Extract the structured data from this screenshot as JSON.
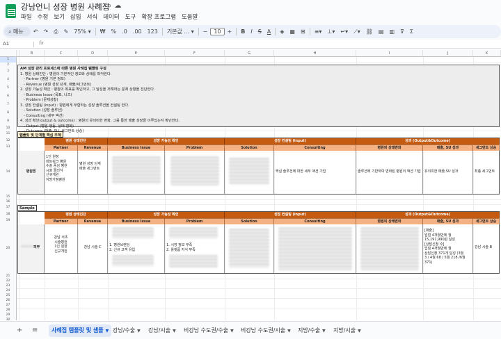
{
  "app": {
    "title": "강남언니 성장 병원 사례집",
    "title_icons": [
      "star-icon",
      "move-to-folder-icon",
      "cloud-status-icon"
    ],
    "menus": [
      "파일",
      "수정",
      "보기",
      "삽입",
      "서식",
      "데이터",
      "도구",
      "확장 프로그램",
      "도움말"
    ]
  },
  "toolbar": {
    "search_label": "메뉴",
    "zoom": "75%",
    "currency": "₩",
    "percent": "%",
    "dec_decrease": ".0",
    "dec_increase": ".00",
    "number_format": "123",
    "font_name": "기본값 ...",
    "font_size": "10"
  },
  "formula_bar": {
    "cell_ref": "A1",
    "fx": "fx"
  },
  "columns": [
    "A",
    "B",
    "C",
    "D",
    "E",
    "F",
    "G",
    "H",
    "I",
    "J",
    "K"
  ],
  "rows": [
    "1",
    "2",
    "3",
    "4",
    "5",
    "6",
    "7",
    "8",
    "9",
    "10",
    "11",
    "12",
    "13",
    "14",
    "15",
    "16",
    "17",
    "18",
    "19",
    "20",
    "21",
    "22",
    "23",
    "24",
    "25",
    "26",
    "27",
    "28",
    "29",
    "30"
  ],
  "instructions": {
    "title": "AM 성장 관리 프로세스에 따른 병원 사례집 템플릿 구성",
    "lines": [
      "1. 병원 상태진단 : 병원의 기본적인 정보와 상태를 파악한다.",
      "   - Partner (병원 기본 정보)",
      "   - Revenue (병원 성장 단계, 매출/세그먼트)",
      "2. 성장 가능성 확인 : 병원의 목표를 확인하고, 그 달성을 저해하는 문제 상황을 진단한다.",
      "   - Business Issue (목표, 니즈)",
      "   - Problem (문제상황)",
      "3. 성장 컨설팅 (input) : 병원에게 부합하는 성장 솔루션을 컨설팅 한다.",
      "   - Solution (성장 솔루션)",
      "   - Consulting (세부 액션)",
      "4. 성과 확인(output & outcome) : 병원의 유의미한 변화, 그를 통한 매출 성장을 이루었는지 확인한다.",
      "   - Output (병원 행동, 상태 변화)",
      "   - Outcome (매출, SU, 세그먼트 상승)"
    ]
  },
  "template_table": {
    "label": "템플릿 및 단계별 핵심 주제",
    "header1": [
      "병원 상태진단",
      "성장 가능성 확인",
      "성장 컨설팅 (input)",
      "성과 (Output&Outcome)"
    ],
    "header2": [
      "Partner",
      "Revenue",
      "Business Issue",
      "Problem",
      "Solution",
      "Consulting",
      "병원의 상태변화",
      "매출, SU 성과",
      "세그먼트 상승"
    ],
    "row_label": "병원명",
    "partner_lines": [
      "1인 원장",
      "네트워크 병원",
      "수술 중심 병원",
      "시술 클리닉",
      "신규개원",
      "지방가점병원"
    ],
    "revenue_lines": [
      "병원 성장 단계",
      "매출 세그먼트"
    ],
    "consulting": "핵심 솔루션에 대한 세부 액션 기입",
    "state_change": "솔루션에 기반하여 변화된 병원의 액션 기입",
    "sales_result": "유의미한 매출,SU 성과",
    "segment_result": "최종 세그먼트"
  },
  "sample_table": {
    "label": "Sample",
    "header1": [
      "병원 상태진단",
      "성장 가능성 확인",
      "성장 컨설팅 (input)",
      "성과 (Output&Outcome)"
    ],
    "header2": [
      "Partner",
      "Revenue",
      "Business Issue",
      "Problem",
      "Solution",
      "Consulting",
      "병원의 상태변화",
      "매출, SU 성과",
      "세그먼트 상승"
    ],
    "row_label_suffix": "피부",
    "partner_lines": [
      "강남 서초",
      "시술병원",
      "1인 원장",
      "신규개원"
    ],
    "revenue": "강남 시술 C",
    "business_issue_lines": [
      "1. 병원브랜딩",
      "2. 신규 고객 유입"
    ],
    "problem_lines": [
      "1. 시장 정보 부족",
      "2. 플랫폼 지식 부족"
    ],
    "sales_lines": [
      "[매출]",
      "입점 4개월만에 월",
      "15,191,990원 달성",
      "",
      "[상담신청 수]",
      "입점 4개월만에 월",
      "상담신청 371개 달성 (3월",
      "3 / 4월 68 / 5월 218 /6월",
      "371)"
    ],
    "segment": "강남 시술 B"
  },
  "sheet_tabs": {
    "add_icon": "+",
    "list_icon": "≡",
    "tabs": [
      "사례집 템플릿 및 샘플",
      "강남/수술",
      "강남/시술",
      "비강남 수도권/수술",
      "비강남 수도권/시술",
      "지방/수술",
      "지방/시술"
    ],
    "active_index": 0
  }
}
